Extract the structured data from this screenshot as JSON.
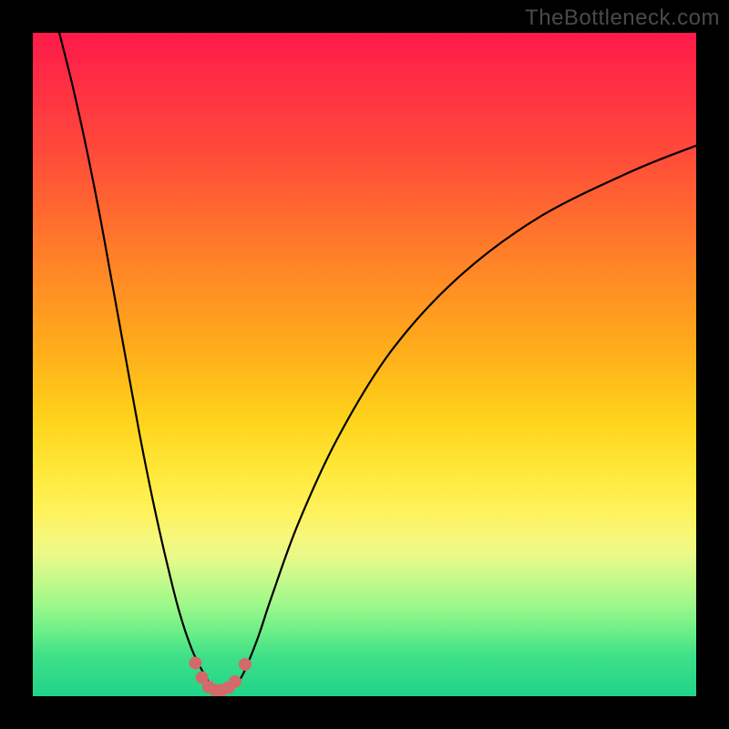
{
  "watermark": "TheBottleneck.com",
  "chart_data": {
    "type": "line",
    "title": "",
    "xlabel": "",
    "ylabel": "",
    "xlim": [
      0,
      100
    ],
    "ylim": [
      0,
      100
    ],
    "series": [
      {
        "name": "bottleneck-curve",
        "x": [
          4,
          6,
          8,
          10,
          12,
          14,
          16,
          18,
          20,
          22,
          24,
          26,
          27,
          28,
          29,
          30,
          31,
          32,
          34,
          36,
          40,
          46,
          54,
          64,
          76,
          90,
          100
        ],
        "y": [
          100,
          92,
          83,
          73,
          62,
          51,
          40,
          30,
          21,
          13,
          7,
          3,
          1.5,
          0.8,
          0.8,
          1.2,
          2.2,
          4,
          9,
          15,
          26,
          39,
          52,
          63,
          72,
          79,
          83
        ]
      }
    ],
    "markers": {
      "name": "highlight-dots",
      "color": "#d36a6a",
      "points": [
        {
          "x": 24.5,
          "y": 5.0
        },
        {
          "x": 25.5,
          "y": 2.8
        },
        {
          "x": 26.5,
          "y": 1.4
        },
        {
          "x": 27.5,
          "y": 0.9
        },
        {
          "x": 28.5,
          "y": 0.9
        },
        {
          "x": 29.5,
          "y": 1.3
        },
        {
          "x": 30.5,
          "y": 2.2
        },
        {
          "x": 32.0,
          "y": 4.8
        }
      ]
    },
    "gradient_stops": [
      {
        "pos": 0,
        "color": "#ff1a4a"
      },
      {
        "pos": 18,
        "color": "#ff4a3a"
      },
      {
        "pos": 32,
        "color": "#ff7a2a"
      },
      {
        "pos": 48,
        "color": "#ffae1a"
      },
      {
        "pos": 58,
        "color": "#ffd21a"
      },
      {
        "pos": 66,
        "color": "#ffe83a"
      },
      {
        "pos": 72,
        "color": "#fff25a"
      },
      {
        "pos": 76,
        "color": "#f7f77a"
      },
      {
        "pos": 79,
        "color": "#e8f98a"
      },
      {
        "pos": 82,
        "color": "#c8fa8a"
      },
      {
        "pos": 86,
        "color": "#a0f88a"
      },
      {
        "pos": 90,
        "color": "#6ef088"
      },
      {
        "pos": 94,
        "color": "#3ee088"
      },
      {
        "pos": 100,
        "color": "#20d488"
      }
    ]
  }
}
